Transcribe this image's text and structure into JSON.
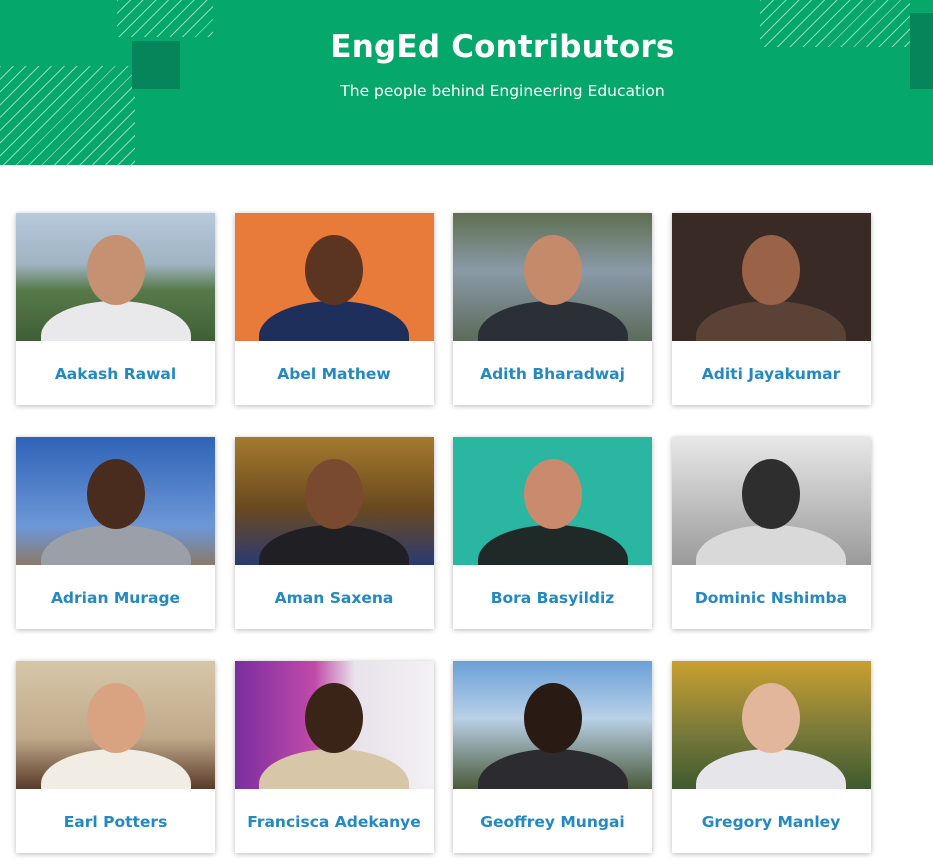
{
  "header": {
    "title": "EngEd Contributors",
    "subtitle": "The people behind Engineering Education"
  },
  "contributors": [
    {
      "name": "Aakash Rawal",
      "bg": "linear-gradient(180deg,#b7c9dc 0%,#9fb3c2 40%,#587a4a 60%,#3f5e36 100%)",
      "skin": "#c69072",
      "shirt": "#e9e9ec"
    },
    {
      "name": "Abel Mathew",
      "bg": "#e87a3a",
      "skin": "#5b3522",
      "shirt": "#1f2f5c"
    },
    {
      "name": "Adith Bharadwaj",
      "bg": "linear-gradient(180deg,#5e6f50 0%,#8a9aa8 45%,#5c6b5a 100%)",
      "skin": "#c48a6a",
      "shirt": "#2b2f36"
    },
    {
      "name": "Aditi Jayakumar",
      "bg": "#3a2a26",
      "skin": "#9a6247",
      "shirt": "#5a4236"
    },
    {
      "name": "Adrian Murage",
      "bg": "linear-gradient(180deg,#2f63b8 0%,#6d97d6 70%,#8a7a6a 100%)",
      "skin": "#4a2c1e",
      "shirt": "#9a9fa8"
    },
    {
      "name": "Aman Saxena",
      "bg": "linear-gradient(180deg,#a57a2e 0%,#6a4a1e 55%,#2a3a72 100%)",
      "skin": "#7a4a30",
      "shirt": "#1f1f24"
    },
    {
      "name": "Bora Basyildiz",
      "bg": "#2ab6a0",
      "skin": "#c98a6e",
      "shirt": "#1f2a28"
    },
    {
      "name": "Dominic Nshimba",
      "bg": "linear-gradient(180deg,#e8e8e8 0%,#9a9a9a 100%)",
      "skin": "#2e2e2e",
      "shirt": "#d9d9d9"
    },
    {
      "name": "Earl Potters",
      "bg": "linear-gradient(180deg,#d6c7a8 0%,#bfa98a 60%,#5a3a2a 100%)",
      "skin": "#d9a382",
      "shirt": "#f1ede4"
    },
    {
      "name": "Francisca Adekanye",
      "bg": "linear-gradient(90deg,#7a2ea0 0%,#c04aa8 40%,#e8e2ea 60%,#f3f1f4 100%)",
      "skin": "#3a2418",
      "shirt": "#d8c6a8"
    },
    {
      "name": "Geoffrey Mungai",
      "bg": "linear-gradient(180deg,#6aa0d8 0%,#b9d0e6 45%,#4a5a3a 100%)",
      "skin": "#2a1a14",
      "shirt": "#2c2c30"
    },
    {
      "name": "Gregory Manley",
      "bg": "linear-gradient(180deg,#c9a030 0%,#7a7a3a 55%,#3e5a2e 100%)",
      "skin": "#e2b69a",
      "shirt": "#e6e6ea"
    }
  ]
}
